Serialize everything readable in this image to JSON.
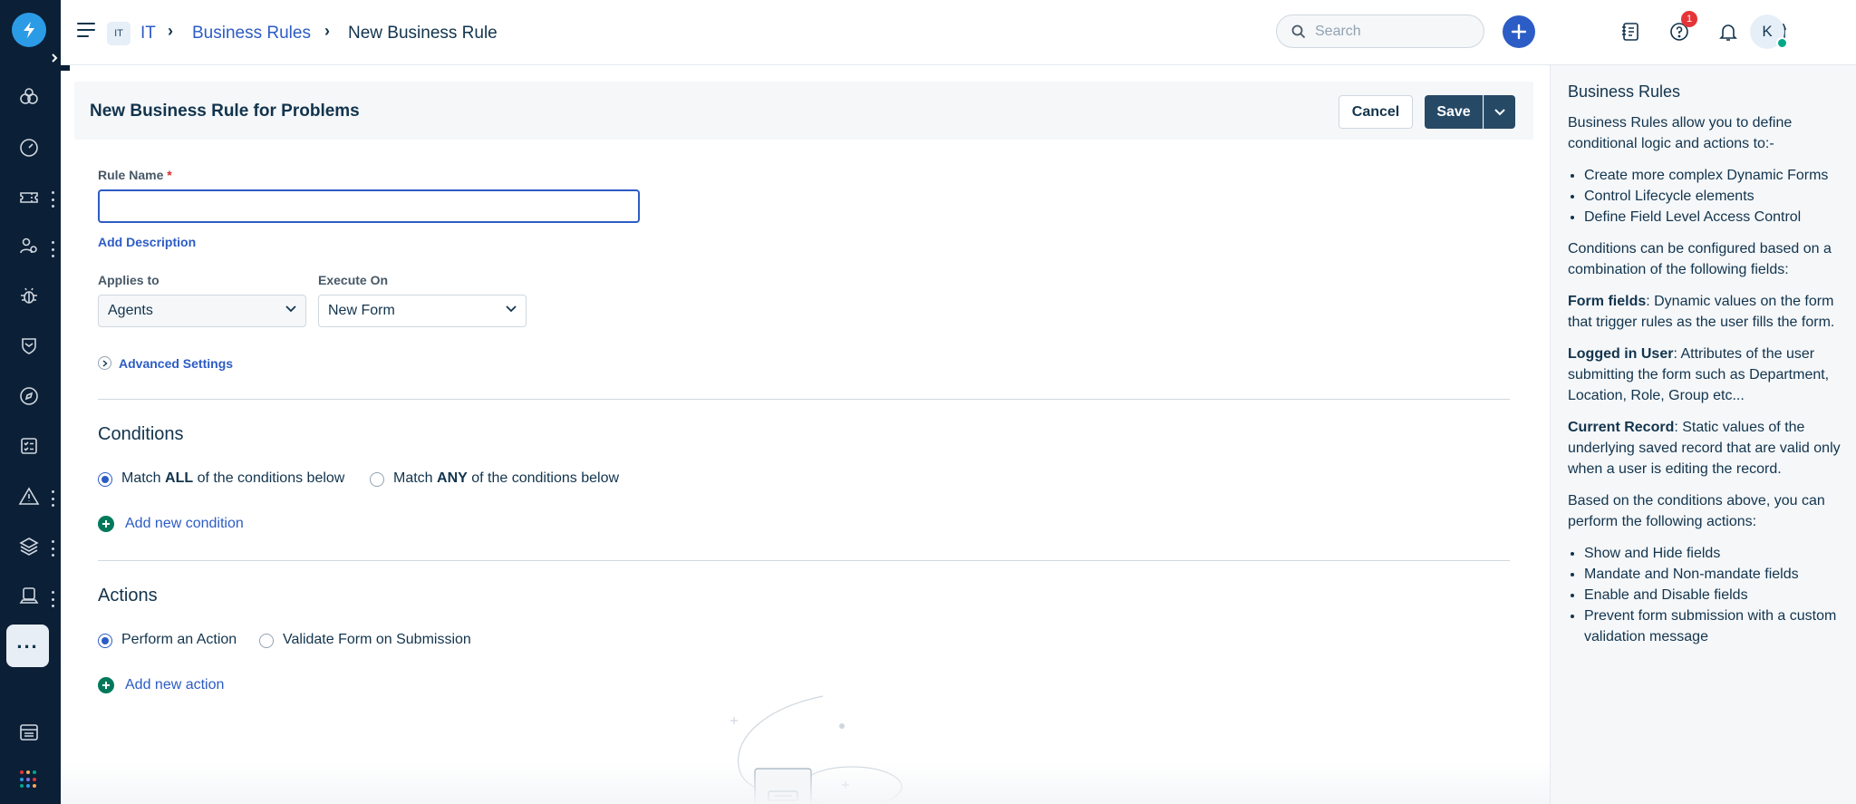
{
  "topbar": {
    "workspace_badge": "IT",
    "breadcrumbs": [
      "IT",
      "Business Rules",
      "New Business Rule"
    ],
    "search_placeholder": "Search",
    "notification_count": "1",
    "avatar_initial": "K"
  },
  "form": {
    "title": "New Business Rule for Problems",
    "cancel_label": "Cancel",
    "save_label": "Save",
    "rule_name_label": "Rule Name",
    "required_mark": "*",
    "rule_name_value": "",
    "add_description": "Add Description",
    "applies_to_label": "Applies to",
    "applies_to_value": "Agents",
    "execute_on_label": "Execute On",
    "execute_on_value": "New Form",
    "advanced_settings": "Advanced Settings"
  },
  "conditions": {
    "heading": "Conditions",
    "match_all": {
      "prefix": "Match ",
      "keyword": "ALL",
      "suffix": " of the conditions below",
      "selected": true
    },
    "match_any": {
      "prefix": "Match ",
      "keyword": "ANY",
      "suffix": " of the conditions below",
      "selected": false
    },
    "add_label": "Add new condition"
  },
  "actions": {
    "heading": "Actions",
    "options": [
      {
        "label": "Perform an Action",
        "selected": true
      },
      {
        "label": "Validate Form on Submission",
        "selected": false
      }
    ],
    "add_label": "Add new action"
  },
  "help_panel": {
    "title": "Business Rules",
    "intro": "Business Rules allow you to define conditional logic and actions to:-",
    "intro_items": [
      "Create more complex Dynamic Forms",
      "Control Lifecycle elements",
      "Define Field Level Access Control"
    ],
    "conditions_text": "Conditions can be configured based on a combination of the following fields:",
    "form_fields_term": "Form fields",
    "form_fields_text": ": Dynamic values on the form that trigger rules as the user fills the form.",
    "logged_user_term": "Logged in User",
    "logged_user_text": ": Attributes of the user submitting the form such as Department, Location, Role, Group etc...",
    "current_record_term": "Current Record",
    "current_record_text": ": Static values of the underlying saved record that are valid only when a user is editing the record.",
    "actions_text": "Based on the conditions above, you can perform the following actions:",
    "action_items": [
      "Show and Hide fields",
      "Mandate and Non-mandate fields",
      "Enable and Disable fields",
      "Prevent form submission with a custom validation message"
    ]
  },
  "colors": {
    "rail_bg": "#0b1f36",
    "brand_blue": "#2c5cc5",
    "save_bg": "#264966",
    "add_green": "#00795b",
    "badge_red": "#e43538"
  },
  "icons": {
    "rail": [
      "logo-icon",
      "expand-icon",
      "dashboard-icon",
      "speedometer-icon",
      "ticket-icon",
      "users-icon",
      "bug-icon",
      "shield-icon",
      "compass-icon",
      "checklist-icon",
      "alert-icon",
      "layers-icon",
      "laptop-icon",
      "more-icon",
      "server-icon",
      "apps-grid-icon"
    ],
    "topbar": [
      "menu-icon",
      "search-icon",
      "plus-icon",
      "catalog-icon",
      "help-icon",
      "bell-icon",
      "store-icon"
    ]
  }
}
